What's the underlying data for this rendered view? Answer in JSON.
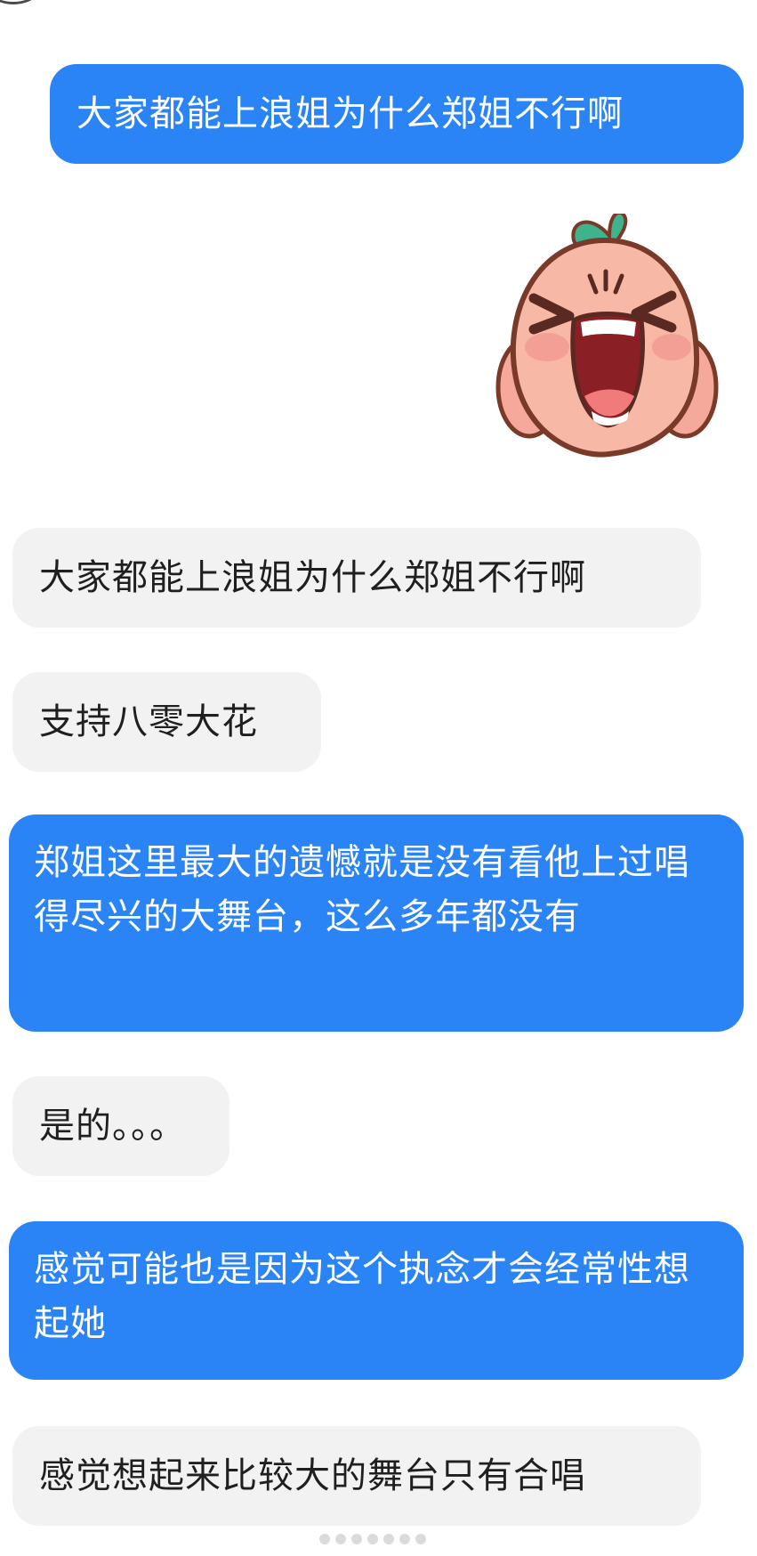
{
  "messages": [
    {
      "side": "out",
      "text": "大家都能上浪姐为什么郑姐不行啊"
    },
    {
      "side": "out",
      "type": "sticker",
      "sticker": "screaming-peach-emoji"
    },
    {
      "side": "in",
      "text": "大家都能上浪姐为什么郑姐不行啊"
    },
    {
      "side": "in",
      "text": "支持八零大花"
    },
    {
      "side": "out",
      "text": "郑姐这里最大的遗憾就是没有看他上过唱得尽兴的大舞台，这么多年都没有"
    },
    {
      "side": "in",
      "text": "是的。。。"
    },
    {
      "side": "out",
      "text": "感觉可能也是因为这个执念才会经常性想起她"
    },
    {
      "side": "in",
      "text": "感觉想起来比较大的舞台只有合唱"
    }
  ],
  "colors": {
    "outgoing_bubble": "#2b84f5",
    "incoming_bubble": "#f2f2f2",
    "outgoing_text": "#ffffff",
    "incoming_text": "#1f1f1f",
    "background": "#ffffff"
  }
}
